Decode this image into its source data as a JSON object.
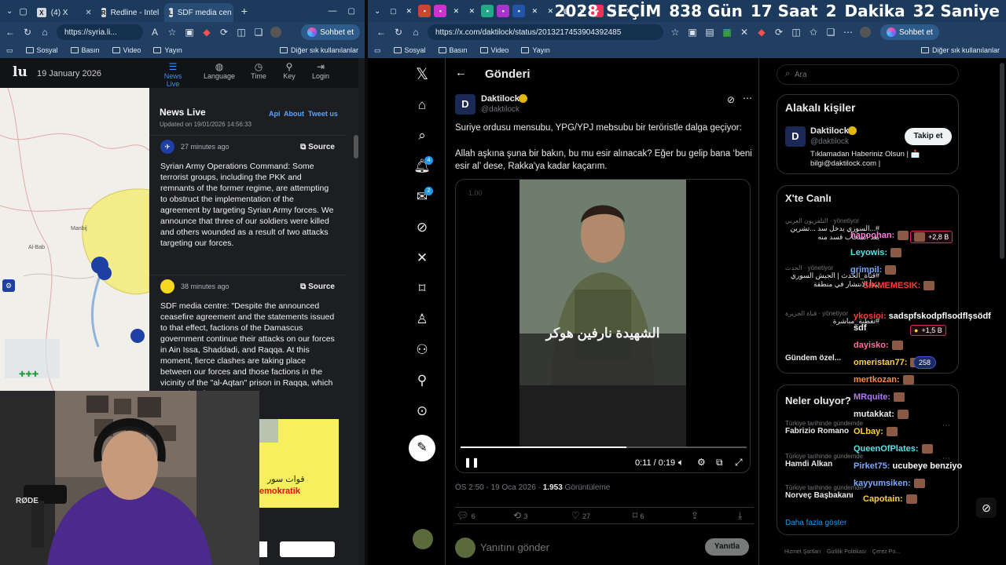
{
  "left_browser": {
    "tabs": [
      {
        "label": "(4) X",
        "favicon": "X"
      },
      {
        "label": "Redline - Intel",
        "favicon": "R"
      },
      {
        "label": "SDF media cen",
        "favicon": "L",
        "active": true
      }
    ],
    "url": "https://syria.li...",
    "sohbet": "Sohbet et",
    "bookmarks": [
      "Sosyal",
      "Basın",
      "Video",
      "Yayın"
    ],
    "bookmarks_right": "Diğer sık kullanılanlar"
  },
  "liveuamap": {
    "logo": "lu",
    "date": "19 January 2026",
    "menu": [
      {
        "label": "News Live",
        "icon": "list-icon",
        "active": true
      },
      {
        "label": "Language",
        "icon": "globe-icon"
      },
      {
        "label": "Time",
        "icon": "clock-icon"
      },
      {
        "label": "Key",
        "icon": "key-icon"
      },
      {
        "label": "Login",
        "icon": "login-icon"
      }
    ],
    "feed_title": "News Live",
    "links": [
      "Api",
      "About",
      "Tweet us"
    ],
    "updated": "Updated on 19/01/2026 14:56:33",
    "items": [
      {
        "time": "27 minutes ago",
        "source": "Source",
        "text": "Syrian Army Operations Command: Some terrorist groups, including the PKK and remnants of the former regime, are attempting to obstruct the implementation of the agreement by targeting Syrian Army forces. We announce that three of our soldiers were killed and others wounded as a result of two attacks targeting our forces."
      },
      {
        "time": "38 minutes ago",
        "source": "Source",
        "text": "SDF media centre: \"Despite the announced ceasefire agreement and the statements issued to that effect, factions of the Damascus government continue their attacks on our forces in Ain Issa, Shaddadi, and Raqqa. At this moment, fierce clashes are taking place between our forces and those factions in the vicinity of the \"al-Aqtan\" prison in Raqqa, which ...rous development.\""
      }
    ],
    "map_labels": [
      "Manbij",
      "Al-Bab"
    ],
    "thumb_text": [
      "قوات سور",
      "emokratik"
    ]
  },
  "right_browser": {
    "countdown": [
      "2028",
      "SEÇİM",
      "838 Gün",
      "17 Saat",
      "2",
      "Dakika",
      "32 Saniye"
    ],
    "url": "https://x.com/daktilock/status/2013217453904392485",
    "sohbet": "Sohbet et",
    "bookmarks": [
      "Sosyal",
      "Basın",
      "Video",
      "Yayın"
    ],
    "bookmarks_right": "Diğer sık kullanılanlar"
  },
  "x": {
    "nav_icons": [
      "x-logo-icon",
      "home-icon",
      "search-icon",
      "bell-icon",
      "mail-icon",
      "grok-icon",
      "x-premium-icon",
      "bookmark-icon",
      "jobs-icon",
      "communities-icon",
      "profile-icon",
      "more-icon",
      "post-icon"
    ],
    "notif_badge": "4",
    "mail_badge": "2",
    "header": "Gönderi",
    "author_name": "Daktilock",
    "author_handle": "@daktilock",
    "text1": "Suriye ordusu mensubu, YPG/YPJ mebsubu bir teröristle dalga geçiyor:",
    "text2": "Allah aşkına şuna bir bakın, bu mu esir alınacak? Eğer bu gelip bana ‘beni esir al’ dese, Rakka'ya kadar kaçarım.",
    "video_overlay": "الشهيدة نارفين هوكر",
    "video_time": "0:11 / 0:19",
    "video_progress": 0.58,
    "timestamp": "ÖS 2:50 - 19 Oca 2026",
    "views_count": "1.953",
    "views_label": "Görüntüleme",
    "actions": [
      {
        "icon": "reply-icon",
        "count": "6"
      },
      {
        "icon": "retweet-icon",
        "count": "3"
      },
      {
        "icon": "like-icon",
        "count": "27"
      },
      {
        "icon": "bookmark-icon",
        "count": "6"
      }
    ],
    "reply_placeholder": "Yanıtını gönder",
    "reply_button": "Yanıtla"
  },
  "x_sidebar": {
    "search_placeholder": "Ara",
    "related_title": "Alakalı kişiler",
    "related_name": "Daktilock",
    "related_handle": "@daktilock",
    "related_bio": "Tıklamadan Haberiniz Olsun | 📩 bilgi@daktilock.com |",
    "follow_button": "Takip et",
    "live_title": "X'te Canlı",
    "live_items": [
      {
        "name": "التلفزيون العربي",
        "status": "yönetiyor",
        "text": "#...السوري يدخل سد ...تشرين بعد انسحاب قسد منه"
      },
      {
        "name": "الحدث",
        "status": "yönetiyor",
        "text": "#قناة_الحدث | الجيش السوري يبدأ الانتشار في منطقة"
      },
      {
        "name": "قناة الجزيرة",
        "status": "yönetiyor",
        "text": "#تغطية_مباشرة"
      }
    ],
    "gundem": "Gündem özel...",
    "whats_title": "Neler oluyor?",
    "trends": [
      {
        "meta": "Türkiye tarihinde gündemde",
        "name": "Fabrizio Romano"
      },
      {
        "meta": "Türkiye tarihinde gündemde",
        "name": "Hamdi Alkan"
      },
      {
        "meta": "Türkiye tarihinde gündemde",
        "name": "Norveç Başbakanı"
      }
    ],
    "show_more": "Daha fazla göster",
    "footer": [
      "Hizmet Şartları",
      "Gizlilik Politikası",
      "Çerez Po..."
    ]
  },
  "chat": [
    {
      "user": "hapoohan:",
      "color": "#ff7ad9",
      "msg": ""
    },
    {
      "user": "Leyowis:",
      "color": "#5de0e6",
      "msg": ""
    },
    {
      "user": "grimpil:",
      "color": "#7aa7ff",
      "msg": ""
    },
    {
      "user": "SIKMEMESIK:",
      "color": "#ff3b3b",
      "msg": ""
    },
    {
      "user": "ykosioi:",
      "color": "#ff3b3b",
      "msg": "sadspfskodpflsodflşsödf sdf"
    },
    {
      "user": "dayisko:",
      "color": "#ff6fa0",
      "msg": ""
    },
    {
      "user": "omeristan77:",
      "color": "#ffd23f",
      "msg": ""
    },
    {
      "user": "mertkozan:",
      "color": "#ff8a3d",
      "msg": ""
    },
    {
      "user": "MRquite:",
      "color": "#b07aff",
      "msg": ""
    },
    {
      "user": "mutakkat:",
      "color": "#e7e9ea",
      "msg": ""
    },
    {
      "user": "OLbay:",
      "color": "#ffd23f",
      "msg": ""
    },
    {
      "user": "QueenOfPlates:",
      "color": "#5de0e6",
      "msg": ""
    },
    {
      "user": "Pirket75:",
      "color": "#7aa7ff",
      "msg": "ucubeye benziyo"
    },
    {
      "user": "kayyumsiken:",
      "color": "#7aa7ff",
      "msg": ""
    },
    {
      "user": "Capotain:",
      "color": "#ffd23f",
      "msg": ""
    }
  ],
  "chat_badges": [
    "+2,8 B",
    "+1,5 B",
    "258"
  ],
  "webcam": {
    "mic_label": "RØDE"
  }
}
